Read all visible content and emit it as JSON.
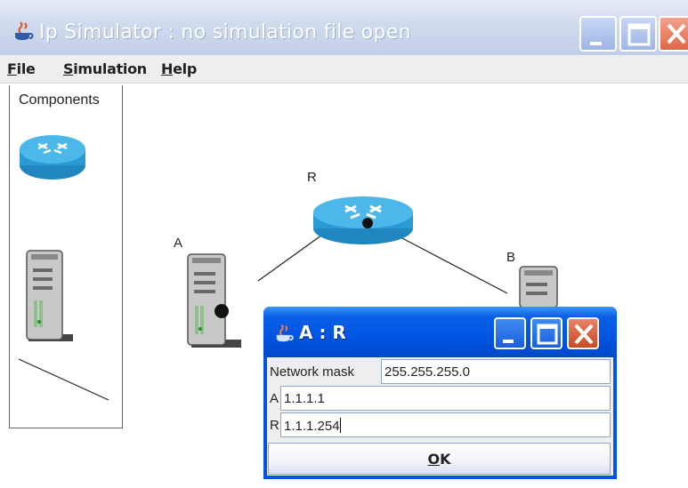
{
  "window": {
    "title": "Ip Simulator : no simulation file open"
  },
  "menu": {
    "items": [
      {
        "first": "F",
        "rest": "ile"
      },
      {
        "first": "S",
        "rest": "imulation"
      },
      {
        "first": "H",
        "rest": "elp"
      }
    ]
  },
  "components_panel": {
    "title": "Components"
  },
  "network": {
    "nodes": [
      {
        "label": "R",
        "kind": "router"
      },
      {
        "label": "A",
        "kind": "host"
      },
      {
        "label": "B",
        "kind": "host"
      }
    ]
  },
  "dialog": {
    "title": "A : R",
    "fields": [
      {
        "label": "Network mask",
        "value": "255.255.255.0"
      },
      {
        "label": "A",
        "value": "1.1.1.1"
      },
      {
        "label": "R",
        "value": "1.1.1.254"
      }
    ],
    "ok_first": "O",
    "ok_rest": "K"
  },
  "colors": {
    "titlebar_text": "#ffffff",
    "xp_blue": "#0054e3",
    "close_red": "#e06748",
    "router_blue": "#33a5dd"
  },
  "icons": {
    "app": "java-cup-icon",
    "router": "router-icon",
    "host": "server-tower-icon"
  }
}
